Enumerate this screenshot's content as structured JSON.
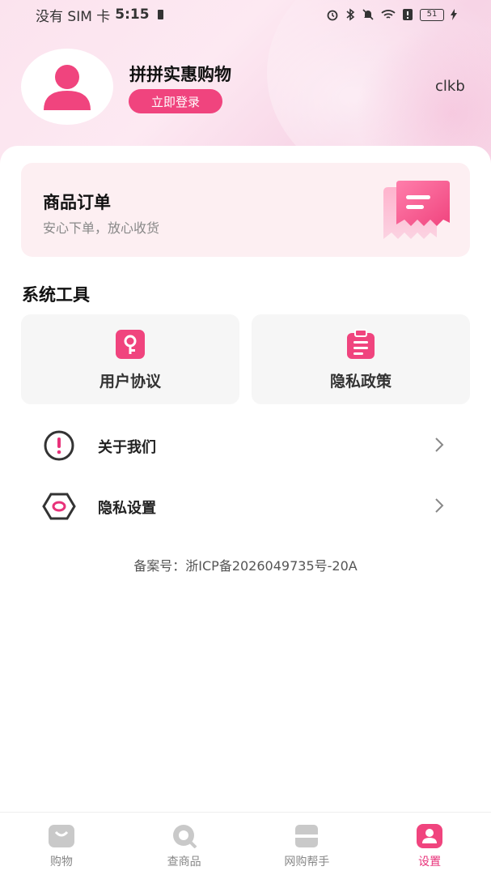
{
  "status_bar": {
    "carrier": "没有 SIM 卡",
    "time": "5:15",
    "battery": "51"
  },
  "header": {
    "app_name": "拼拼实惠购物",
    "login_label": "立即登录",
    "user_tag": "clkb"
  },
  "order_card": {
    "title": "商品订单",
    "subtitle": "安心下单，放心收货"
  },
  "tools": {
    "section_title": "系统工具",
    "items": [
      {
        "label": "用户协议",
        "icon": "key-document-icon"
      },
      {
        "label": "隐私政策",
        "icon": "clipboard-icon"
      }
    ]
  },
  "menu": {
    "items": [
      {
        "label": "关于我们",
        "icon": "info-circle-icon"
      },
      {
        "label": "隐私设置",
        "icon": "hexagon-icon"
      }
    ]
  },
  "icp": "备案号：浙ICP备2026049735号-20A",
  "tabbar": {
    "items": [
      {
        "label": "购物",
        "icon": "shopping-bag-icon",
        "active": false
      },
      {
        "label": "查商品",
        "icon": "search-icon",
        "active": false
      },
      {
        "label": "网购帮手",
        "icon": "helper-icon",
        "active": false
      },
      {
        "label": "设置",
        "icon": "user-settings-icon",
        "active": true
      }
    ]
  },
  "colors": {
    "accent": "#f0447e",
    "active_tab": "#e8327a",
    "inactive_tab_icon": "#c9c9c9"
  }
}
